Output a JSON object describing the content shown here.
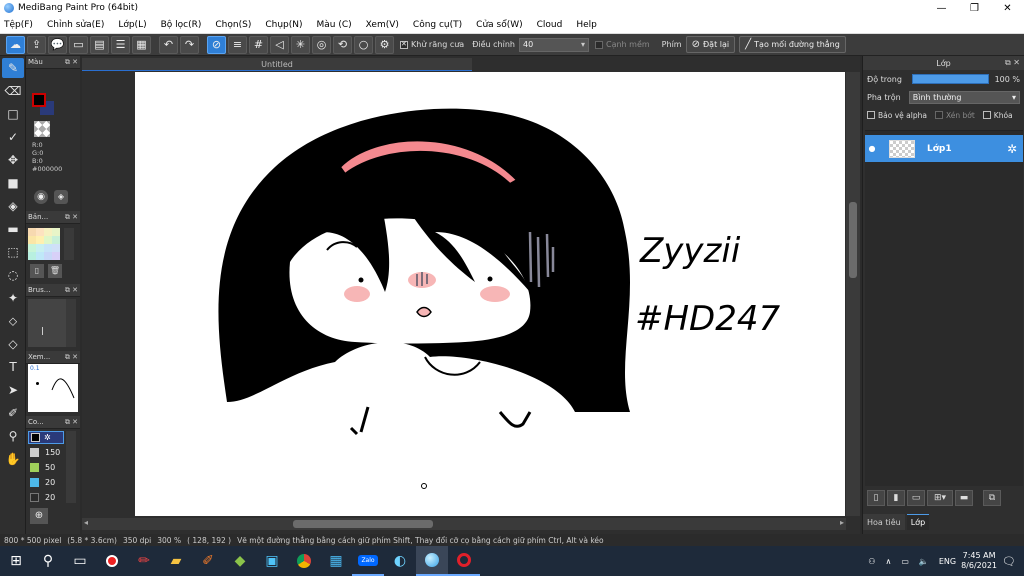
{
  "window": {
    "title": "MediBang Paint Pro (64bit)",
    "min_glyph": "—",
    "max_glyph": "❐",
    "close_glyph": "✕"
  },
  "menu": [
    "Tệp(F)",
    "Chỉnh sửa(E)",
    "Lớp(L)",
    "Bộ lọc(R)",
    "Chọn(S)",
    "Chụp(N)",
    "Màu (C)",
    "Xem(V)",
    "Công cụ(T)",
    "Cửa sổ(W)",
    "Cloud",
    "Help"
  ],
  "toolbar": {
    "antialias_label": "Khử răng cưa",
    "correction_label": "Điều chỉnh",
    "correction_value": "40",
    "snap_label": "Cạnh mềm",
    "pen_label": "Phím",
    "reset_label": "Đặt lại",
    "create_line_label": "Tạo mối đường thẳng"
  },
  "left_panels": {
    "color_title": "Màu",
    "rgb": {
      "r": "R:0",
      "g": "G:0",
      "b": "B:0",
      "hex": "#000000"
    },
    "palette_title": "Bản...",
    "brush_title": "Brus...",
    "preview_title": "Xem...",
    "preview_value": "0.1",
    "color_list_title": "Co...",
    "color_list": [
      "150",
      "50",
      "20",
      "20"
    ],
    "primary_color": "#000000",
    "secondary_color": "#2a3a7a"
  },
  "document": {
    "tab_title": "Untitled"
  },
  "right_panel": {
    "title": "Lớp",
    "opacity_label": "Độ trong",
    "opacity_value": "100 %",
    "opacity": 1.0,
    "blend_label": "Pha trộn",
    "blend_value": "Bình thường",
    "protect_alpha": "Bảo vệ alpha",
    "clipping": "Xén bớt",
    "lock": "Khóa",
    "layer_name": "Lớp1",
    "tabs": [
      "Hoa tiêu",
      "Lớp"
    ]
  },
  "status": {
    "size": "800 * 500 pixel",
    "physical": "(5.8 * 3.6cm)",
    "dpi": "350 dpi",
    "zoom": "300 %",
    "cursor": "( 128, 192 )",
    "hint": "Vẽ một đường thẳng bằng cách giữ phím Shift, Thay đổi cỡ cọ bằng cách giữ phím Ctrl, Alt và kéo"
  },
  "canvas_text": {
    "line1": "Zyyzii",
    "line2": "#HD247"
  },
  "taskbar": {
    "lang": "ENG",
    "time": "7:45 AM",
    "date": "8/6/2021",
    "zalo": "Zalo"
  },
  "colors": {
    "accent": "#2f7fd6",
    "headband": "#f4898f",
    "blush": "#f7b6b6"
  }
}
